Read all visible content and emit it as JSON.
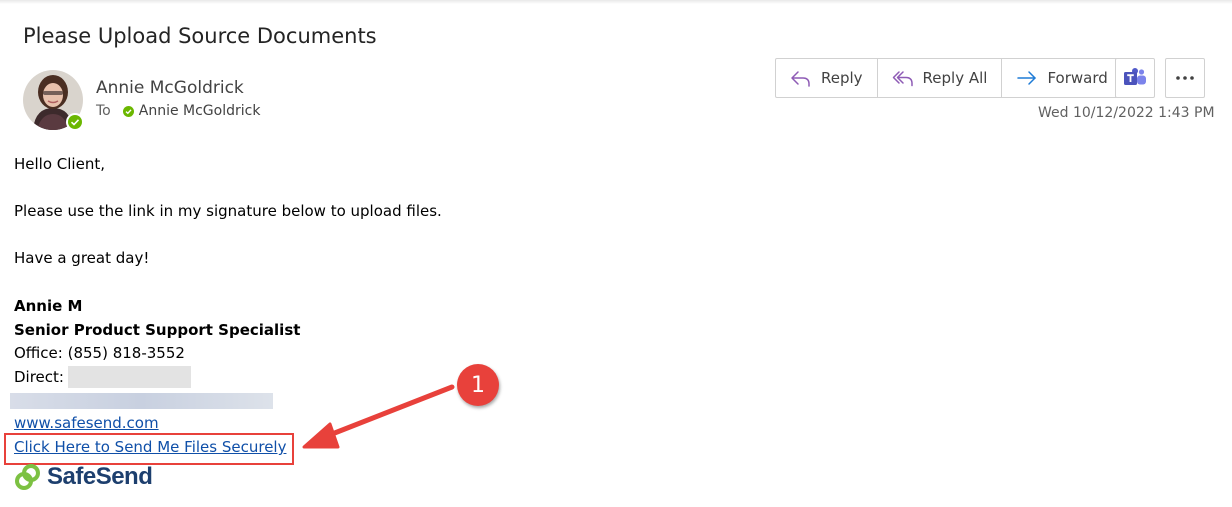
{
  "email": {
    "subject": "Please Upload Source Documents",
    "sender_name": "Annie McGoldrick",
    "to_label": "To",
    "recipient": "Annie McGoldrick",
    "date": "Wed 10/12/2022 1:43 PM"
  },
  "actions": {
    "reply": "Reply",
    "reply_all": "Reply All",
    "forward": "Forward",
    "teams_icon": "teams-icon",
    "more_icon": "more-icon"
  },
  "body": {
    "greeting": "Hello Client,",
    "line1": "Please use the link in my signature below to upload files.",
    "line2": "Have a great day!"
  },
  "signature": {
    "name": "Annie M",
    "title": "Senior Product Support Specialist",
    "office": "Office: (855) 818-3552",
    "direct_label": "Direct:",
    "website": "www.safesend.com",
    "upload_link": "Click Here to Send Me Files Securely",
    "logo_text": "SafeSend"
  },
  "annotation": {
    "step_number": "1"
  },
  "colors": {
    "accent_red": "#e8413b",
    "link_blue": "#0f4fa8",
    "presence_green": "#6bb700",
    "logo_navy": "#1d3f6e",
    "logo_green": "#7cc142"
  }
}
